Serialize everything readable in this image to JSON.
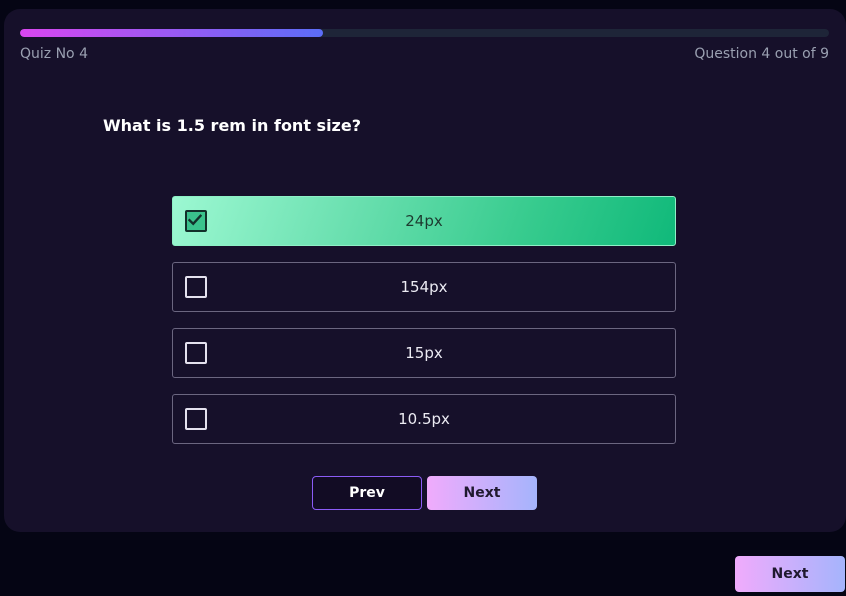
{
  "quiz": {
    "label": "Quiz No 4",
    "question_count": "Question 4 out of 9",
    "progress_fraction": 0.375
  },
  "question": {
    "text": "What is 1.5 rem in font size?",
    "options": [
      {
        "label": "24px",
        "selected": true
      },
      {
        "label": "154px",
        "selected": false
      },
      {
        "label": "15px",
        "selected": false
      },
      {
        "label": "10.5px",
        "selected": false
      }
    ]
  },
  "buttons": {
    "prev_label": "Prev",
    "next_label": "Next",
    "outer_next_label": "Next"
  },
  "colors": {
    "selected_option": "#10b97a",
    "progress_start": "#d946ef",
    "progress_end": "#5b6df7",
    "button_gradient_start": "#f0abfc",
    "button_gradient_end": "#a5b4fc"
  },
  "icons": {
    "checkbox_checked": "check-icon"
  }
}
